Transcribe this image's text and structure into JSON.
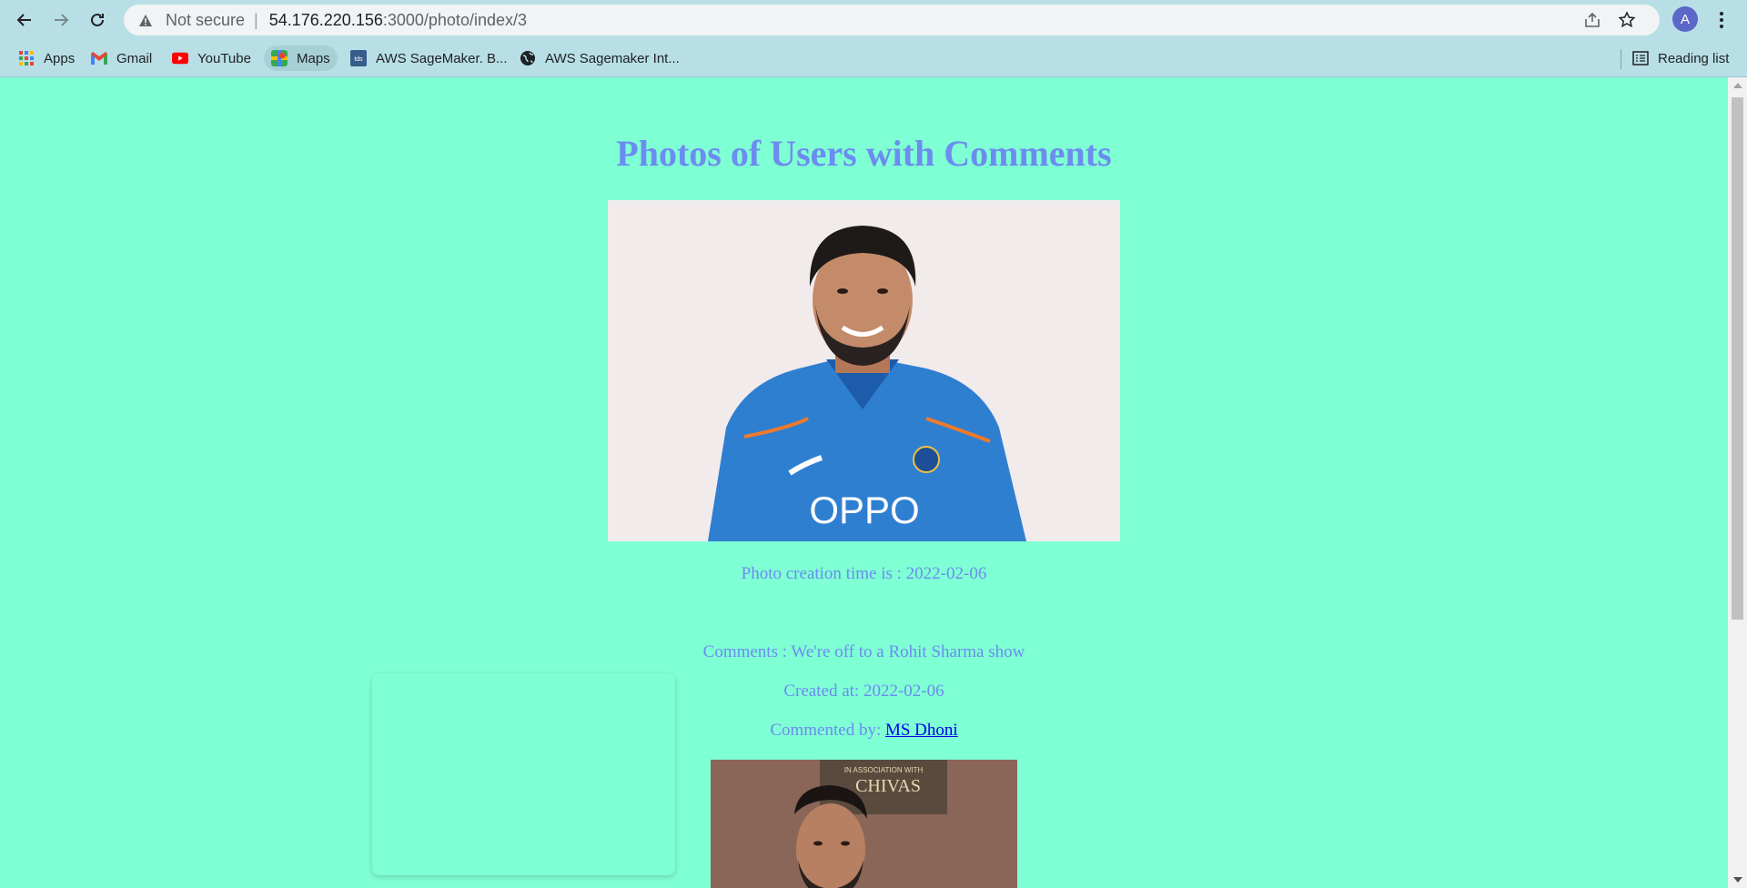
{
  "browser": {
    "security_label": "Not secure",
    "separator": "|",
    "url_host": "54.176.220.156",
    "url_path": ":3000/photo/index/3",
    "profile_initial": "A",
    "bookmarks": [
      {
        "label": "Apps",
        "icon": "apps-grid-icon"
      },
      {
        "label": "Gmail",
        "icon": "gmail-icon"
      },
      {
        "label": "YouTube",
        "icon": "youtube-icon"
      },
      {
        "label": "Maps",
        "icon": "maps-icon"
      },
      {
        "label": "AWS SageMaker. B...",
        "icon": "tds-icon"
      },
      {
        "label": "AWS Sagemaker Int...",
        "icon": "globe-icon"
      }
    ],
    "reading_list": "Reading list",
    "colors": {
      "chrome": "#b8dfe6",
      "page_bg": "#7fffd4",
      "text": "#6c8cf0",
      "link": "#0000ee"
    }
  },
  "page": {
    "title": "Photos of Users with Comments",
    "photo_creation_prefix": "Photo creation time is : ",
    "photo_creation_date": "2022-02-06",
    "comment_prefix": "Comments : ",
    "comment_text": "We're off to a Rohit Sharma show",
    "created_prefix": "Created at: ",
    "created_date": "2022-02-06",
    "commented_by_prefix": "Commented by: ",
    "commented_by_name": "MS Dhoni",
    "photo2_banner_small": "IN ASSOCIATION WITH",
    "photo2_banner_brand": "CHIVAS",
    "jersey_brand": "OPPO"
  }
}
